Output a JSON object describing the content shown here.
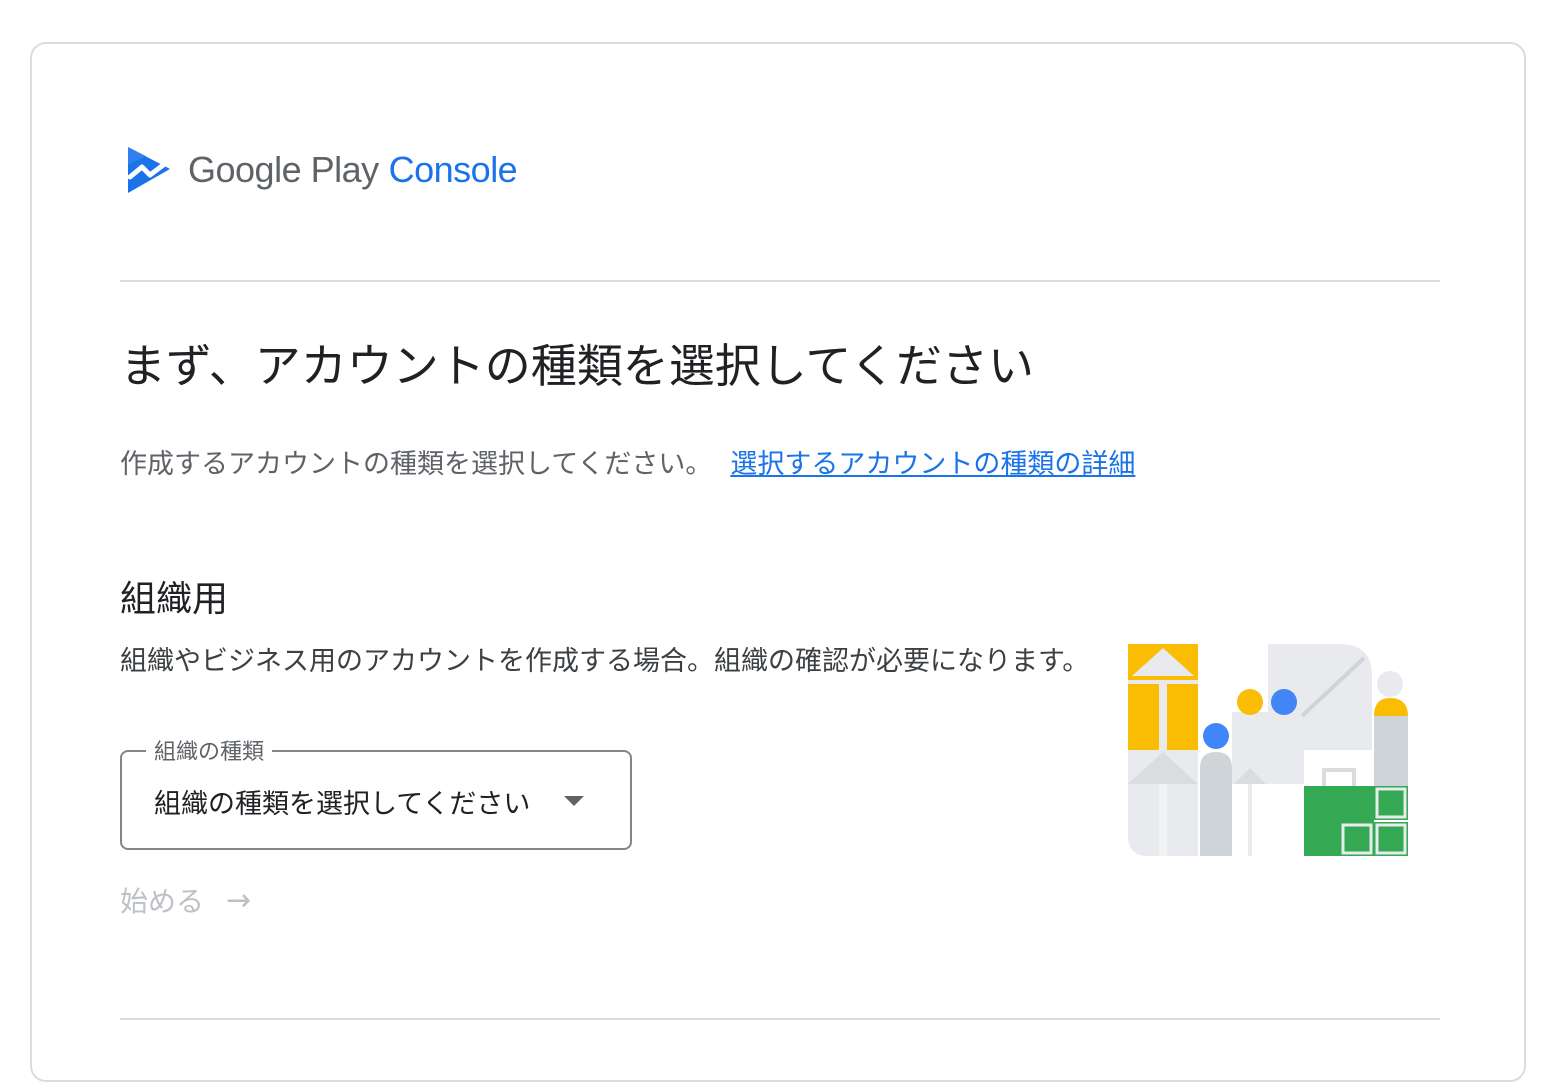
{
  "logo": {
    "brand": "Google Play",
    "product": "Console"
  },
  "page": {
    "title": "まず、アカウントの種類を選択してください",
    "subtitle": "作成するアカウントの種類を選択してください。",
    "details_link": "選択するアカウントの種類の詳細"
  },
  "section": {
    "title": "組織用",
    "description": "組織やビジネス用のアカウントを作成する場合。組織の確認が必要になります。",
    "select": {
      "label": "組織の種類",
      "value": "組織の種類を選択してください"
    },
    "start_button": "始める",
    "start_button_enabled": false
  },
  "colors": {
    "accent": "#1a73e8",
    "yellow": "#fbbc04",
    "green": "#34a853",
    "grey": "#dadce0"
  }
}
